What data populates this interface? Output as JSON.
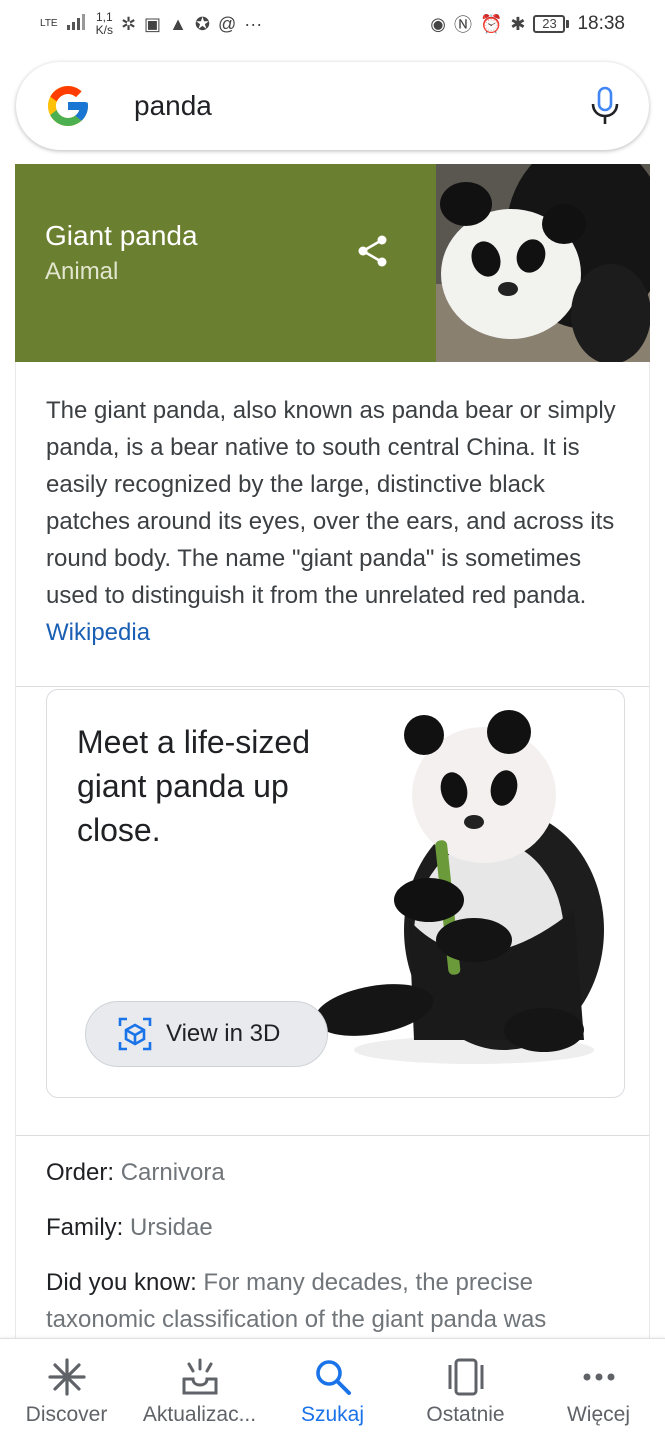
{
  "status_bar": {
    "network": "LTE",
    "speed_value": "1,1",
    "speed_unit": "K/s",
    "battery": "23",
    "time": "18:38"
  },
  "search": {
    "query": "panda",
    "logo": "google-g-logo",
    "mic_icon": "microphone-icon"
  },
  "knowledge_panel": {
    "title": "Giant panda",
    "subtitle": "Animal",
    "header_color": "#6b7f30",
    "description": "The giant panda, also known as panda bear or simply panda, is a bear native to south central China. It is easily recognized by the large, distinctive black patches around its eyes, over the ears, and across its round body. The name \"giant panda\" is sometimes used to distinguish it from the unrelated red panda.",
    "source_link": "Wikipedia"
  },
  "ar_card": {
    "text": "Meet a life-sized giant panda up close.",
    "button_label": "View in 3D"
  },
  "facts": [
    {
      "label": "Order:",
      "value": "Carnivora"
    },
    {
      "label": "Family:",
      "value": "Ursidae"
    },
    {
      "label": "Did you know:",
      "value": "For many decades, the precise taxonomic classification of the giant panda was"
    }
  ],
  "bottom_nav": {
    "items": [
      {
        "label": "Discover",
        "icon": "asterisk-icon"
      },
      {
        "label": "Aktualizac...",
        "icon": "inbox-sparkle-icon"
      },
      {
        "label": "Szukaj",
        "icon": "search-icon",
        "active": true
      },
      {
        "label": "Ostatnie",
        "icon": "recent-tabs-icon"
      },
      {
        "label": "Więcej",
        "icon": "more-dots-icon"
      }
    ],
    "active_color": "#1a73e8"
  }
}
